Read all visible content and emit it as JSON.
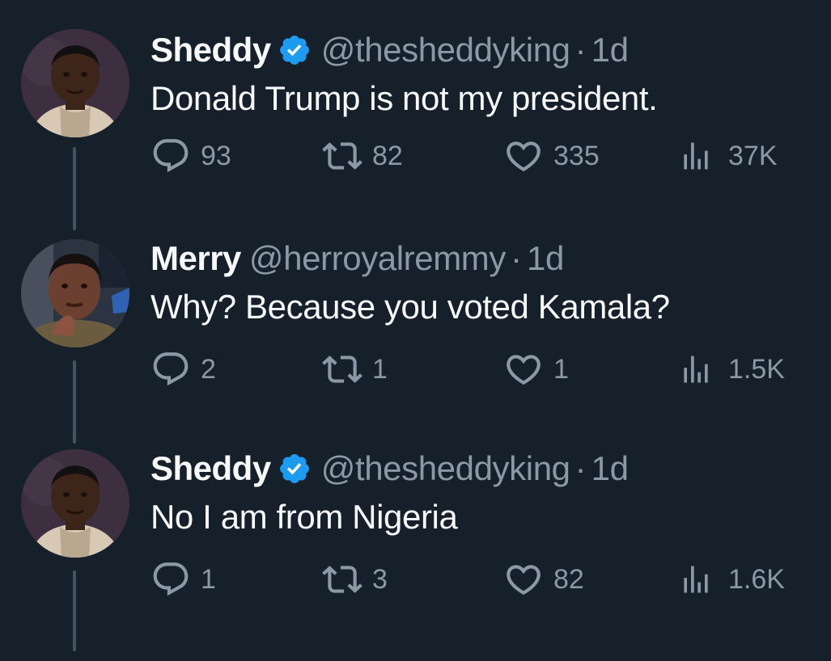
{
  "tweets": [
    {
      "name": "Sheddy",
      "verified": true,
      "handle": "@thesheddyking",
      "separator": "·",
      "time": "1d",
      "text": "Donald Trump is not my president.",
      "replies": "93",
      "retweets": "82",
      "likes": "335",
      "views": "37K"
    },
    {
      "name": "Merry",
      "verified": false,
      "handle": "@herroyalremmy",
      "separator": "·",
      "time": "1d",
      "text": "Why? Because you voted Kamala?",
      "replies": "2",
      "retweets": "1",
      "likes": "1",
      "views": "1.5K"
    },
    {
      "name": "Sheddy",
      "verified": true,
      "handle": "@thesheddyking",
      "separator": "·",
      "time": "1d",
      "text": "No I am from Nigeria",
      "replies": "1",
      "retweets": "3",
      "likes": "82",
      "views": "1.6K"
    }
  ],
  "icons": {
    "reply": "reply-icon",
    "retweet": "retweet-icon",
    "like": "heart-icon",
    "views": "views-icon",
    "verified": "verified-badge-icon"
  },
  "colors": {
    "background": "#15202b",
    "primary_text": "#f7f9f9",
    "secondary_text": "#8b98a5",
    "verified_blue": "#1d9bf0",
    "thread_line": "#425364"
  }
}
